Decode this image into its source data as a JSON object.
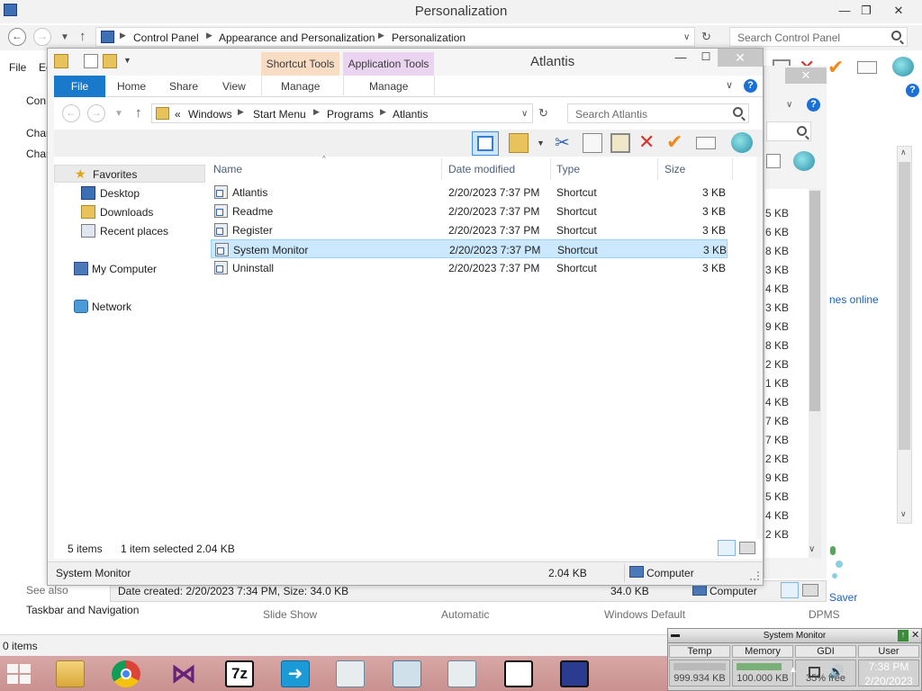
{
  "control_panel": {
    "title": "Personalization",
    "breadcrumb": [
      "Control Panel",
      "Appearance and Personalization",
      "Personalization"
    ],
    "search_placeholder": "Search Control Panel",
    "menu": [
      "File",
      "Ec"
    ],
    "side_links": [
      "Con",
      "Chan",
      "Chan"
    ],
    "see_also": "See also",
    "taskbar_nav": "Taskbar and Navigation",
    "bottom_labels": [
      "Slide Show",
      "Automatic",
      "Windows Default",
      "DPMS"
    ],
    "right_link": "nes online",
    "saver_text": "Saver",
    "size_column": [
      "5 KB",
      "6 KB",
      "8 KB",
      "3 KB",
      "4 KB",
      "3 KB",
      "9 KB",
      "8 KB",
      "2 KB",
      "1 KB",
      "4 KB",
      "7 KB",
      "7 KB",
      "2 KB",
      "9 KB",
      "5 KB",
      "4 KB",
      "2 KB"
    ],
    "status": "0 items"
  },
  "behind_window": {
    "status_left": "Date created: 2/20/2023 7:34 PM, Size: 34.0 KB",
    "status_size": "34.0 KB",
    "status_location": "Computer"
  },
  "explorer": {
    "title": "Atlantis",
    "context_tabs": [
      "Shortcut Tools",
      "Application Tools"
    ],
    "ribbon_tabs": {
      "file": "File",
      "home": "Home",
      "share": "Share",
      "view": "View",
      "manage1": "Manage",
      "manage2": "Manage"
    },
    "breadcrumb": {
      "overflow": "«",
      "items": [
        "Windows",
        "Start Menu",
        "Programs",
        "Atlantis"
      ]
    },
    "search_placeholder": "Search Atlantis",
    "nav": {
      "favorites": "Favorites",
      "desktop": "Desktop",
      "downloads": "Downloads",
      "recent": "Recent places",
      "computer": "My Computer",
      "network": "Network"
    },
    "columns": {
      "name": "Name",
      "date": "Date modified",
      "type": "Type",
      "size": "Size"
    },
    "files": [
      {
        "name": "Atlantis",
        "date": "2/20/2023 7:37 PM",
        "type": "Shortcut",
        "size": "3 KB"
      },
      {
        "name": "Readme",
        "date": "2/20/2023 7:37 PM",
        "type": "Shortcut",
        "size": "3 KB"
      },
      {
        "name": "Register",
        "date": "2/20/2023 7:37 PM",
        "type": "Shortcut",
        "size": "3 KB"
      },
      {
        "name": "System Monitor",
        "date": "2/20/2023 7:37 PM",
        "type": "Shortcut",
        "size": "3 KB"
      },
      {
        "name": "Uninstall",
        "date": "2/20/2023 7:37 PM",
        "type": "Shortcut",
        "size": "3 KB"
      }
    ],
    "selected_index": 3,
    "status": {
      "items": "5 items",
      "selected": "1 item selected  2.04 KB"
    },
    "bottom": {
      "name": "System Monitor",
      "size": "2.04 KB",
      "location": "Computer"
    }
  },
  "system_monitor": {
    "title": "System Monitor",
    "columns": [
      "Temp",
      "Memory",
      "GDI",
      "User"
    ],
    "values": [
      "999.934 KB",
      "100.000 KB",
      "35% free",
      ""
    ]
  },
  "clock": {
    "time": "7:38 PM",
    "date": "2/20/2023"
  },
  "taskbar_apps": [
    "start-button",
    "file-explorer",
    "chrome",
    "visual-studio",
    "7-zip",
    "remote-app",
    "window-app",
    "control-panel-app",
    "window-app-2",
    "ascii-app",
    "system-monitor-app"
  ]
}
